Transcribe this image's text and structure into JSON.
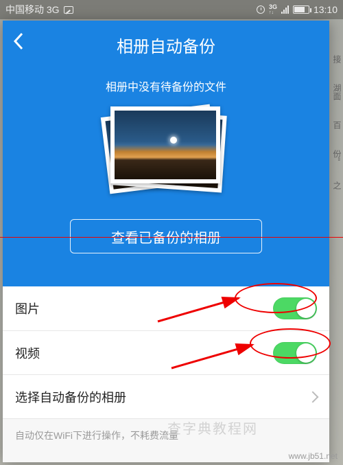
{
  "status": {
    "carrier": "中国移动 3G",
    "time": "13:10",
    "net_label_top": "3G",
    "net_label_bottom": "↑↓"
  },
  "header": {
    "title": "相册自动备份",
    "subtitle": "相册中没有待备份的文件",
    "view_button": "查看已备份的相册"
  },
  "rows": {
    "image": {
      "label": "图片",
      "on": true
    },
    "video": {
      "label": "视频",
      "on": true
    },
    "select": {
      "label": "选择自动备份的相册"
    }
  },
  "hint": "自动仅在WiFi下进行操作，不耗费流量",
  "watermark": {
    "site": "www.jb51.net",
    "brand": "查字典教程网"
  },
  "annotation_color": "#e00",
  "bg_fragments": [
    "接",
    "湖面",
    "百",
    "份\"",
    "之"
  ]
}
